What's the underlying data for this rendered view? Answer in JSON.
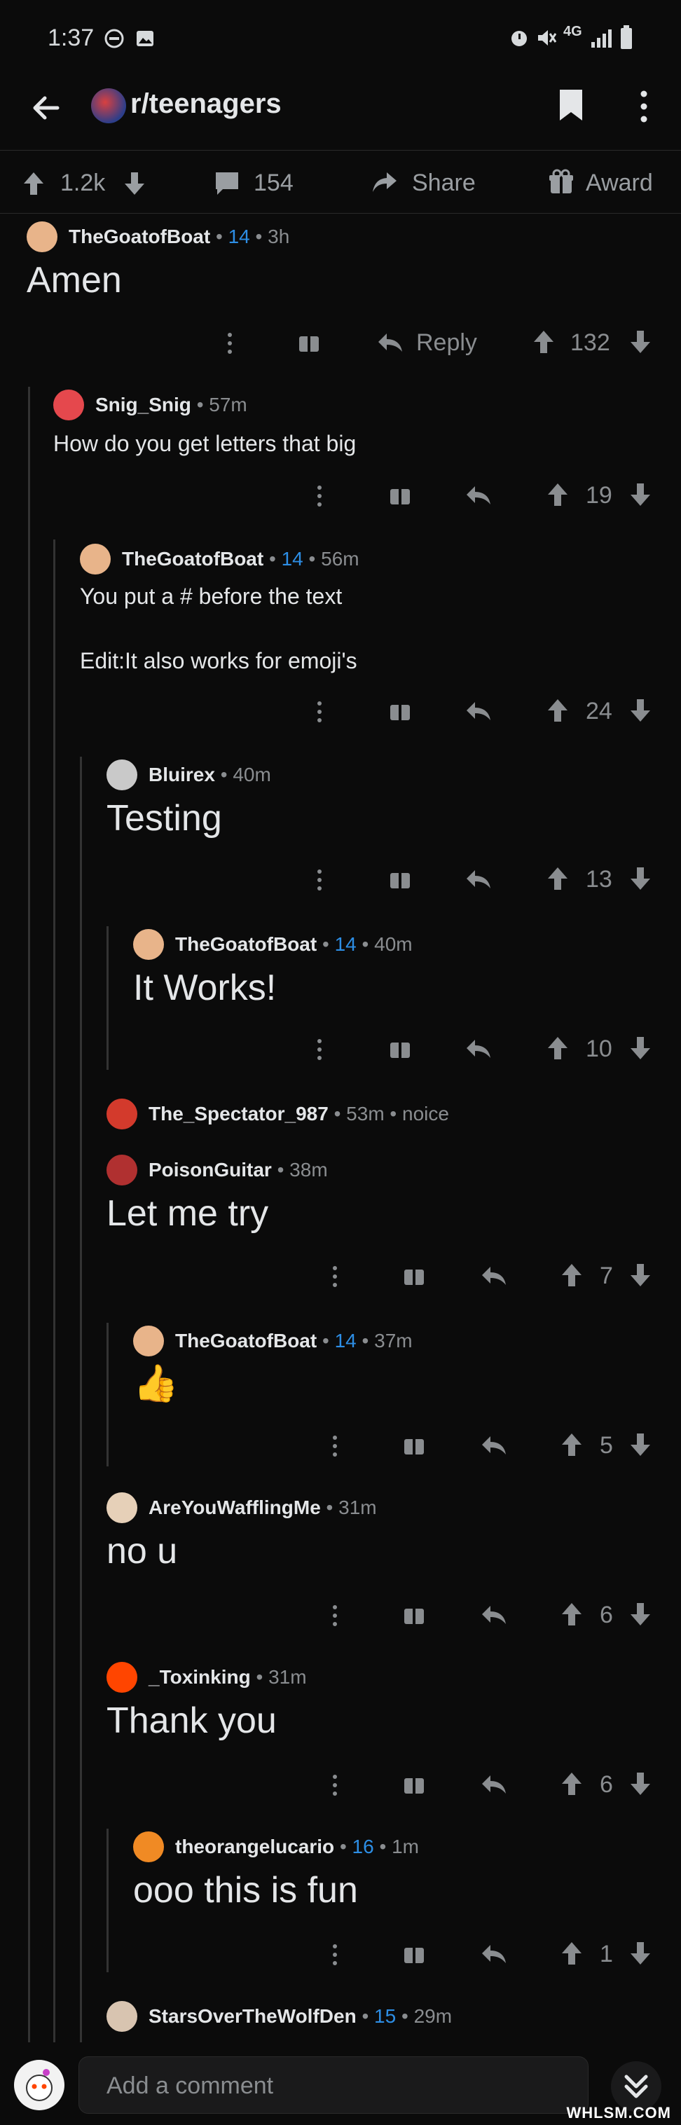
{
  "status": {
    "time": "1:37",
    "network": "4G"
  },
  "header": {
    "subreddit": "r/teenagers"
  },
  "post_actions": {
    "votes": "1.2k",
    "comments": "154",
    "share": "Share",
    "award": "Award"
  },
  "comments": [
    {
      "user": "TheGoatofBoat",
      "flair": "14",
      "time": "3h",
      "text": "Amen",
      "reply": "Reply",
      "votes": "132"
    },
    {
      "user": "Snig_Snig",
      "time": "57m",
      "text": "How do you get letters that big",
      "votes": "19"
    },
    {
      "user": "TheGoatofBoat",
      "flair": "14",
      "time": "56m",
      "text": "You put a # before the text",
      "text2": "Edit:It also works for emoji's",
      "votes": "24"
    },
    {
      "user": "Bluirex",
      "time": "40m",
      "text": "Testing",
      "votes": "13"
    },
    {
      "user": "TheGoatofBoat",
      "flair": "14",
      "time": "40m",
      "text": "It Works!",
      "votes": "10"
    },
    {
      "user": "The_Spectator_987",
      "time": "53m",
      "note": "noice"
    },
    {
      "user": "PoisonGuitar",
      "time": "38m",
      "text": "Let me try",
      "votes": "7"
    },
    {
      "user": "TheGoatofBoat",
      "flair": "14",
      "time": "37m",
      "text": "👍",
      "votes": "5"
    },
    {
      "user": "AreYouWafflingMe",
      "time": "31m",
      "text": "no u",
      "votes": "6"
    },
    {
      "user": "_Toxinking",
      "time": "31m",
      "text": "Thank you",
      "votes": "6"
    },
    {
      "user": "theorangelucario",
      "flair": "16",
      "time": "1m",
      "text": "ooo this is fun",
      "votes": "1"
    },
    {
      "user": "StarsOverTheWolfDen",
      "flair": "15",
      "time": "29m"
    }
  ],
  "composer": {
    "placeholder": "Add a comment"
  },
  "watermark": "WHLSM.COM",
  "colors": {
    "background": "#0b0b0b",
    "flair": "#2d8ee5",
    "muted": "#8a8d90"
  }
}
